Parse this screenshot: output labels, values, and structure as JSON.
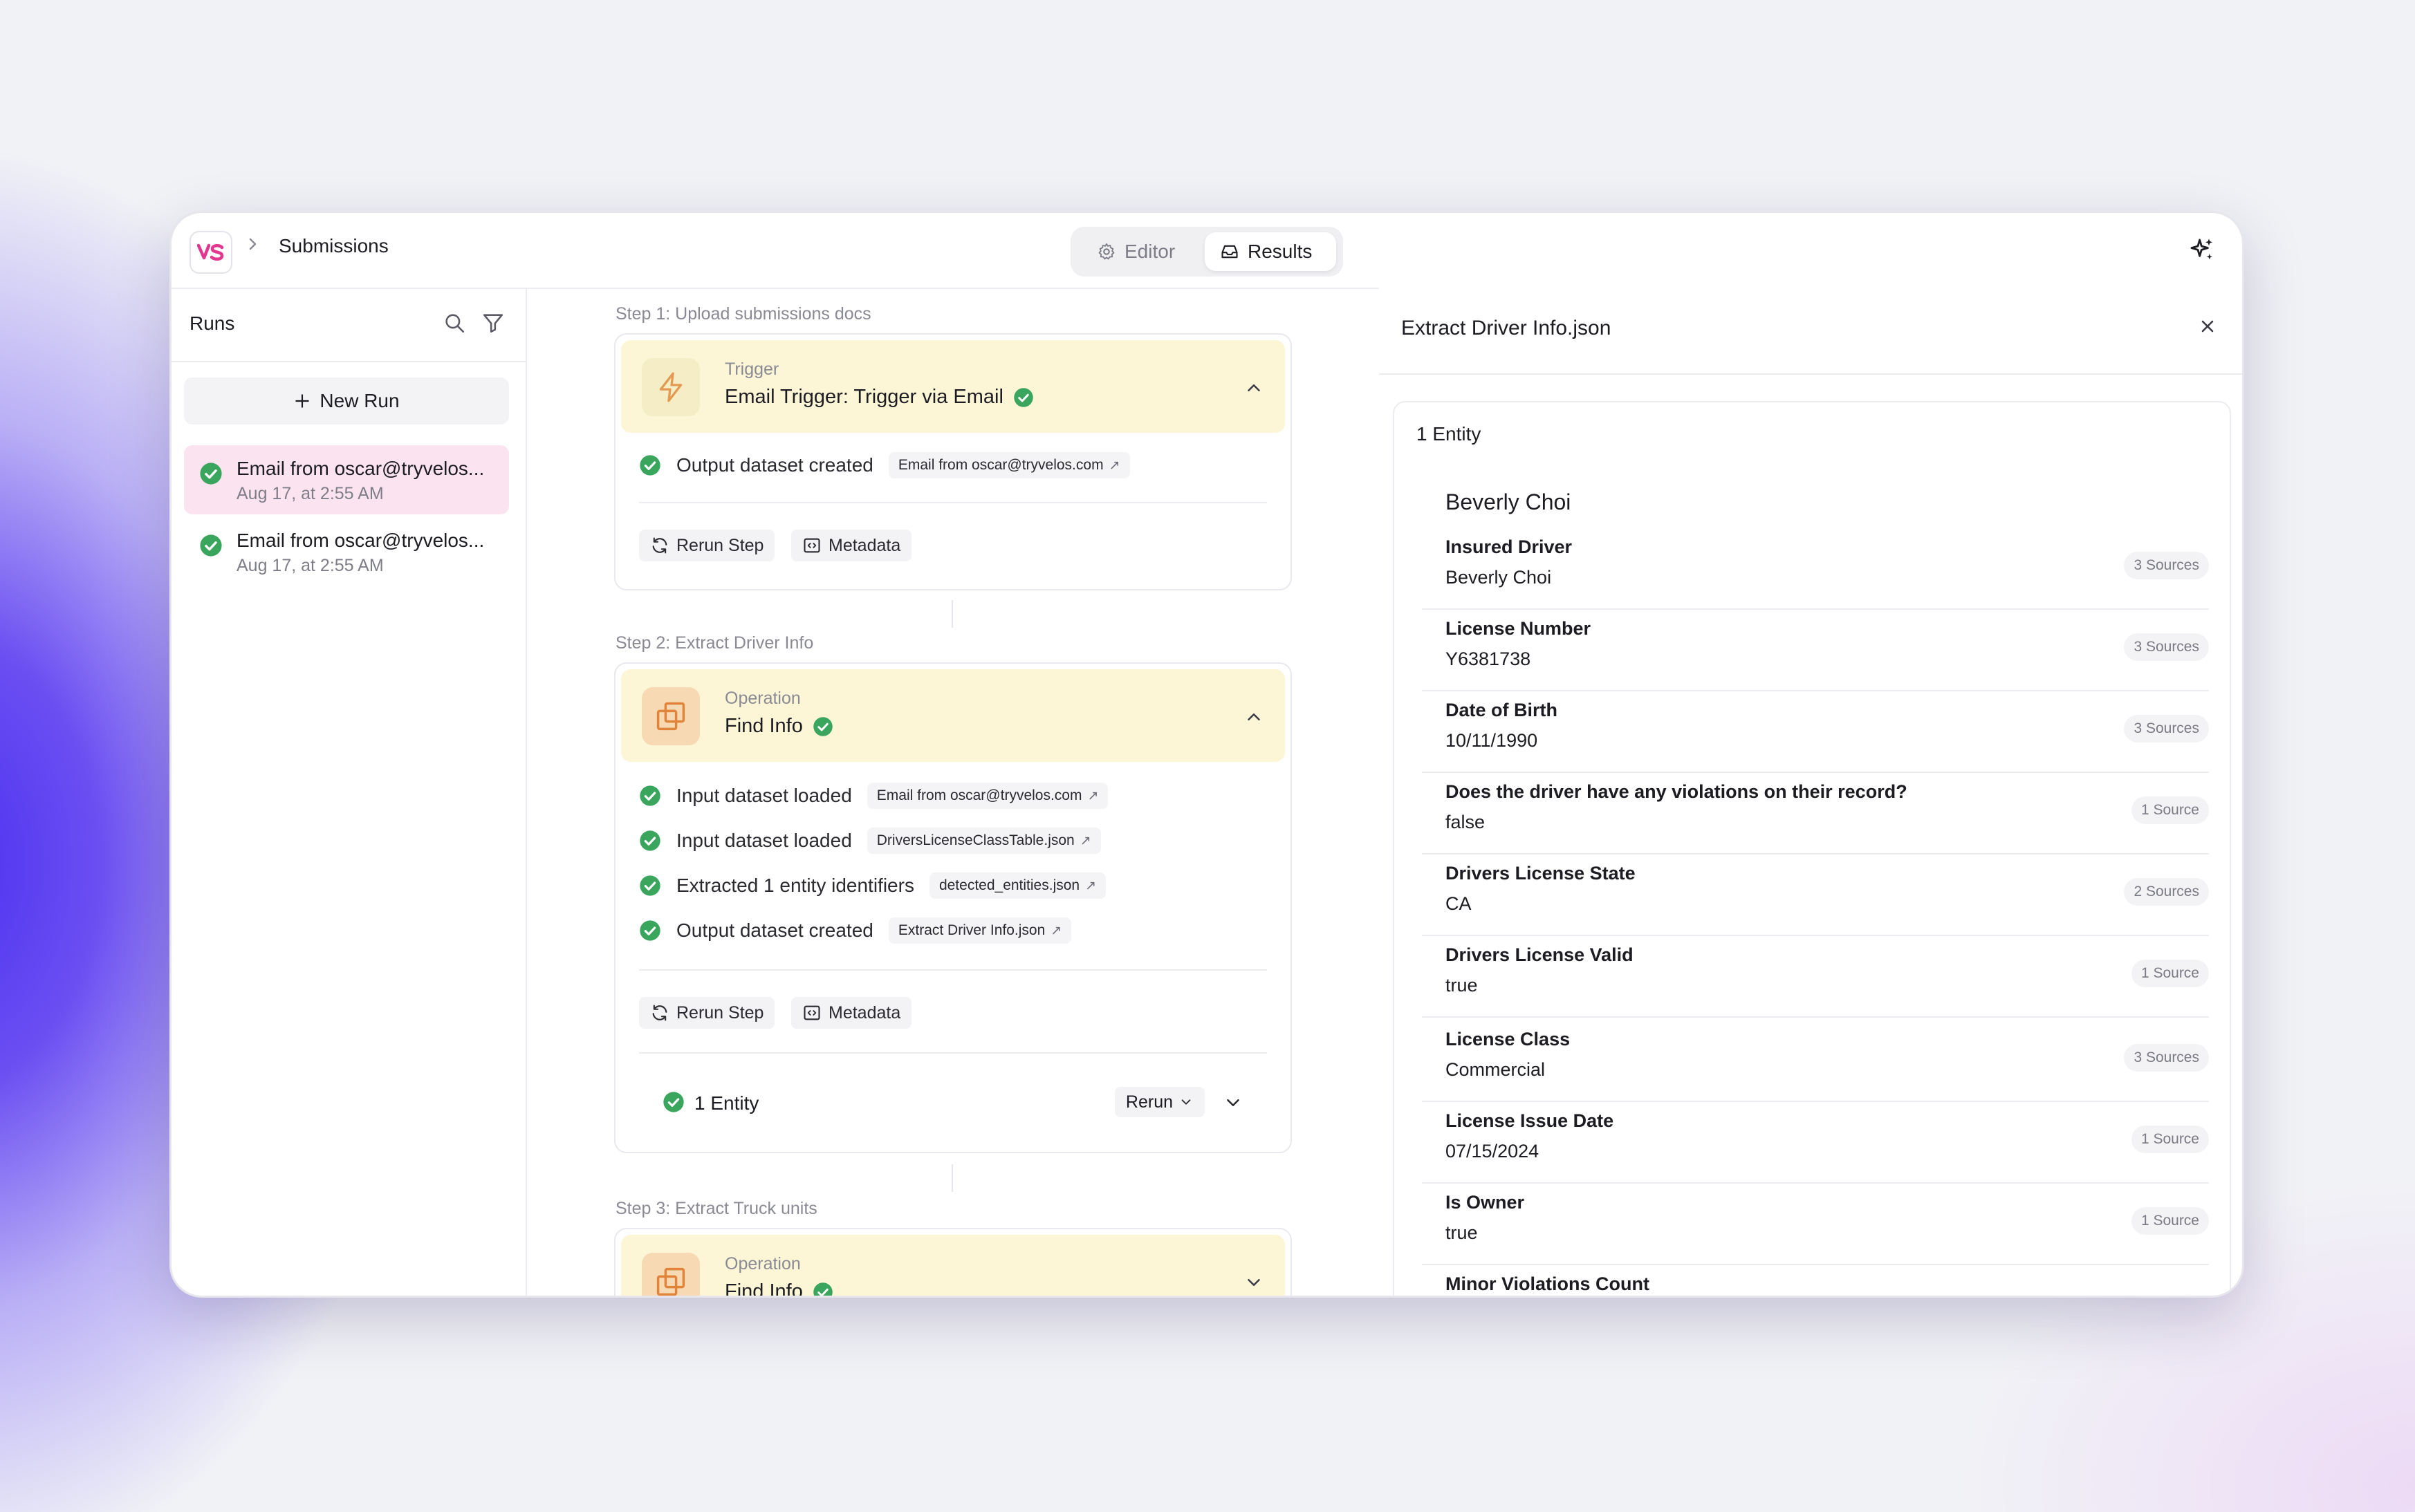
{
  "header": {
    "breadcrumb": "Submissions",
    "tabs": {
      "editor": "Editor",
      "results": "Results"
    },
    "active_tab": "Results"
  },
  "sidebar": {
    "title": "Runs",
    "new_run": "New Run",
    "runs": [
      {
        "title": "Email from oscar@tryvelos...",
        "time": "Aug 17, at 2:55 AM",
        "selected": true
      },
      {
        "title": "Email from oscar@tryvelos...",
        "time": "Aug 17, at 2:55 AM",
        "selected": false
      }
    ]
  },
  "steps": [
    {
      "label": "Step 1: Upload submissions docs",
      "type": "Trigger",
      "name": "Email Trigger: Trigger via Email",
      "rows": [
        {
          "text": "Output dataset created",
          "pill": "Email from oscar@tryvelos.com"
        }
      ],
      "actions": {
        "rerun": "Rerun Step",
        "metadata": "Metadata"
      }
    },
    {
      "label": "Step 2: Extract Driver Info",
      "type": "Operation",
      "name": "Find Info",
      "rows": [
        {
          "text": "Input dataset loaded",
          "pill": "Email from oscar@tryvelos.com"
        },
        {
          "text": "Input dataset loaded",
          "pill": "DriversLicenseClassTable.json"
        },
        {
          "text": "Extracted 1 entity identifiers",
          "pill": "detected_entities.json"
        },
        {
          "text": "Output dataset created",
          "pill": "Extract Driver Info.json"
        }
      ],
      "actions": {
        "rerun": "Rerun Step",
        "metadata": "Metadata"
      },
      "entity": {
        "label": "1 Entity",
        "rerun": "Rerun"
      }
    },
    {
      "label": "Step 3: Extract Truck units",
      "type": "Operation",
      "name": "Find Info"
    }
  ],
  "panel": {
    "title": "Extract Driver Info.json",
    "entity_count": "1 Entity",
    "entity_name": "Beverly Choi",
    "fields": [
      {
        "key": "Insured Driver",
        "value": "Beverly Choi",
        "sources": "3 Sources"
      },
      {
        "key": "License Number",
        "value": "Y6381738",
        "sources": "3 Sources"
      },
      {
        "key": "Date of Birth",
        "value": "10/11/1990",
        "sources": "3 Sources"
      },
      {
        "key": "Does the driver have any violations on their record?",
        "value": "false",
        "sources": "1 Source"
      },
      {
        "key": "Drivers License State",
        "value": "CA",
        "sources": "2 Sources"
      },
      {
        "key": "Drivers License Valid",
        "value": "true",
        "sources": "1 Source"
      },
      {
        "key": "License Class",
        "value": "Commercial",
        "sources": "3 Sources"
      },
      {
        "key": "License Issue Date",
        "value": "07/15/2024",
        "sources": "1 Source"
      },
      {
        "key": "Is Owner",
        "value": "true",
        "sources": "1 Source"
      },
      {
        "key": "Minor Violations Count",
        "value": "",
        "sources": ""
      }
    ]
  },
  "colors": {
    "accent_pink": "#e3378f",
    "success_green": "#3aa55d",
    "header_yellow": "#fcf6d6",
    "selected_run": "#fbe4f0"
  },
  "icons": [
    "vs-logo-icon",
    "chevron-right-icon",
    "gear-icon",
    "inbox-icon",
    "sparkle-icon",
    "search-icon",
    "filter-icon",
    "plus-icon",
    "check-circle-icon",
    "bolt-icon",
    "layers-icon",
    "chevron-up-icon",
    "chevron-down-icon",
    "refresh-icon",
    "code-icon",
    "external-link-icon",
    "close-icon"
  ]
}
